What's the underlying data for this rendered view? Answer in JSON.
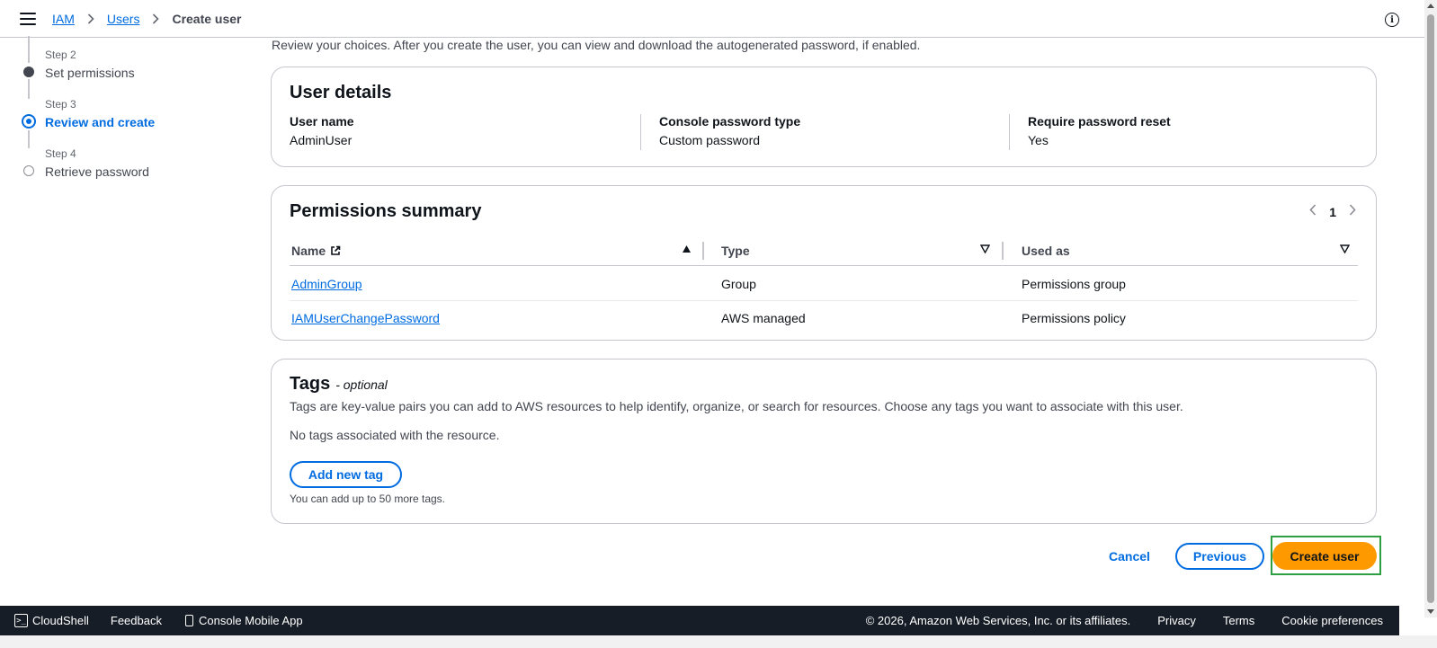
{
  "header": {
    "breadcrumb": [
      {
        "label": "IAM"
      },
      {
        "label": "Users"
      },
      {
        "label": "Create user"
      }
    ]
  },
  "steps": [
    {
      "num": "Step 2",
      "title": "Set permissions",
      "state": "done"
    },
    {
      "num": "Step 3",
      "title": "Review and create",
      "state": "active"
    },
    {
      "num": "Step 4",
      "title": "Retrieve password",
      "state": "todo"
    }
  ],
  "intro": "Review your choices. After you create the user, you can view and download the autogenerated password, if enabled.",
  "user_details": {
    "title": "User details",
    "fields": [
      {
        "label": "User name",
        "value": "AdminUser"
      },
      {
        "label": "Console password type",
        "value": "Custom password"
      },
      {
        "label": "Require password reset",
        "value": "Yes"
      }
    ]
  },
  "permissions": {
    "title": "Permissions summary",
    "page": "1",
    "columns": [
      "Name",
      "Type",
      "Used as"
    ],
    "rows": [
      {
        "name": "AdminGroup",
        "type": "Group",
        "used_as": "Permissions group"
      },
      {
        "name": "IAMUserChangePassword",
        "type": "AWS managed",
        "used_as": "Permissions policy"
      }
    ]
  },
  "tags": {
    "title": "Tags",
    "optional": "- optional",
    "description": "Tags are key-value pairs you can add to AWS resources to help identify, organize, or search for resources. Choose any tags you want to associate with this user.",
    "empty": "No tags associated with the resource.",
    "add_label": "Add new tag",
    "hint": "You can add up to 50 more tags."
  },
  "actions": {
    "cancel": "Cancel",
    "previous": "Previous",
    "create": "Create user"
  },
  "footer": {
    "cloudshell": "CloudShell",
    "feedback": "Feedback",
    "mobile_app": "Console Mobile App",
    "copyright": "© 2026, Amazon Web Services, Inc. or its affiliates.",
    "privacy": "Privacy",
    "terms": "Terms",
    "cookies": "Cookie preferences"
  },
  "colors": {
    "link": "#006ce0",
    "primary_button": "#ff9900",
    "footer_bg": "#161d26",
    "focus_outline": "#2ea043"
  }
}
